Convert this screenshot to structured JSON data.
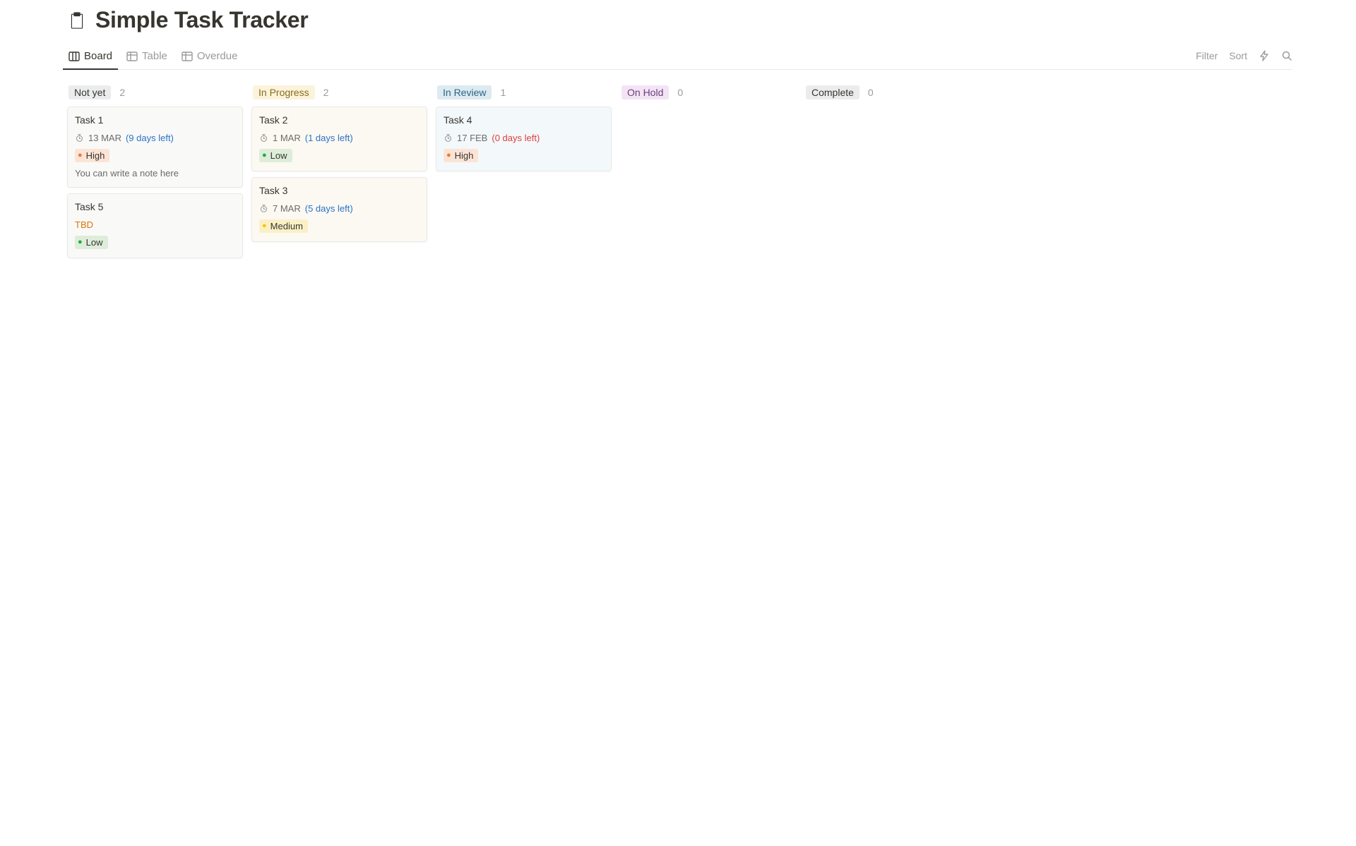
{
  "header": {
    "icon": "clipboard-icon",
    "title": "Simple Task Tracker"
  },
  "tabs": [
    {
      "id": "board",
      "label": "Board",
      "icon": "board-icon",
      "active": true
    },
    {
      "id": "table",
      "label": "Table",
      "icon": "table-icon",
      "active": false
    },
    {
      "id": "overdue",
      "label": "Overdue",
      "icon": "table-icon",
      "active": false
    }
  ],
  "toolbar": {
    "filter": "Filter",
    "sort": "Sort"
  },
  "columns": [
    {
      "id": "not-yet",
      "label": "Not yet",
      "count": "2",
      "pillClass": "status-not-yet",
      "cards": [
        {
          "title": "Task 1",
          "bg": "card-bg-grey",
          "date": "13 MAR",
          "daysLeft": "(9 days left)",
          "daysClass": "days-left-blue",
          "priority": {
            "label": "High",
            "class": "priority-high",
            "dotColor": "#f0762f"
          },
          "note": "You can write a note here"
        },
        {
          "title": "Task 5",
          "bg": "card-bg-grey",
          "tbd": "TBD",
          "priority": {
            "label": "Low",
            "class": "priority-low",
            "dotColor": "#1fab3e"
          }
        }
      ]
    },
    {
      "id": "in-progress",
      "label": "In Progress",
      "count": "2",
      "pillClass": "status-in-progress",
      "cards": [
        {
          "title": "Task 2",
          "bg": "card-bg-yellow",
          "date": "1 MAR",
          "daysLeft": "(1 days left)",
          "daysClass": "days-left-blue",
          "priority": {
            "label": "Low",
            "class": "priority-low",
            "dotColor": "#1fab3e"
          }
        },
        {
          "title": "Task 3",
          "bg": "card-bg-yellow",
          "date": "7 MAR",
          "daysLeft": "(5 days left)",
          "daysClass": "days-left-blue",
          "priority": {
            "label": "Medium",
            "class": "priority-medium",
            "dotColor": "#f2c90a"
          }
        }
      ]
    },
    {
      "id": "in-review",
      "label": "In Review",
      "count": "1",
      "pillClass": "status-in-review",
      "cards": [
        {
          "title": "Task 4",
          "bg": "card-bg-blue",
          "date": "17 FEB",
          "daysLeft": "(0 days left)",
          "daysClass": "days-left-red",
          "priority": {
            "label": "High",
            "class": "priority-high",
            "dotColor": "#f0762f"
          }
        }
      ]
    },
    {
      "id": "on-hold",
      "label": "On Hold",
      "count": "0",
      "pillClass": "status-on-hold",
      "cards": []
    },
    {
      "id": "complete",
      "label": "Complete",
      "count": "0",
      "pillClass": "status-complete",
      "cards": []
    }
  ]
}
